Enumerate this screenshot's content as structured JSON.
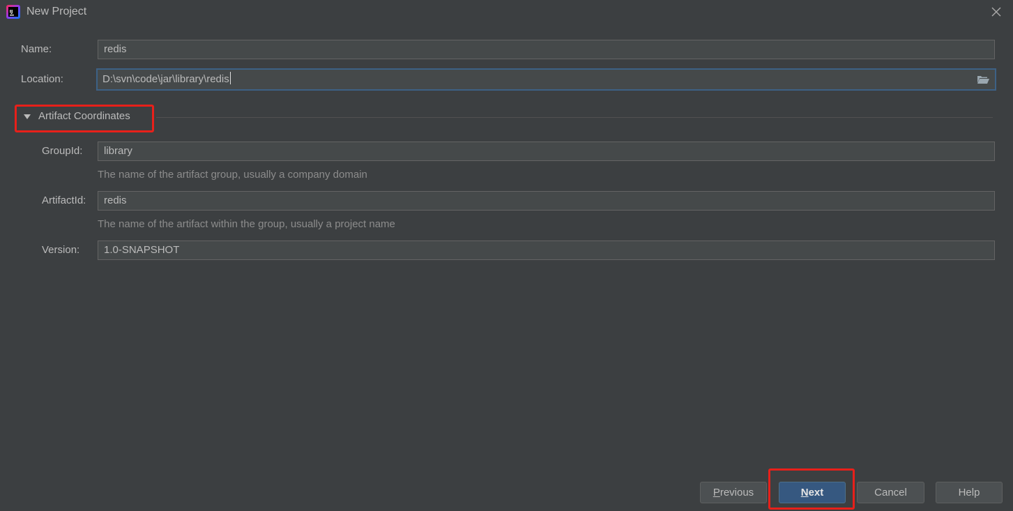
{
  "window": {
    "title": "New Project",
    "app_icon_text": "IJ"
  },
  "form": {
    "name": {
      "label": "Name:",
      "value": "redis"
    },
    "location": {
      "label": "Location:",
      "value": "D:\\svn\\code\\jar\\library\\redis"
    }
  },
  "section": {
    "label": "Artifact Coordinates",
    "expanded": true
  },
  "artifact": {
    "group_id": {
      "label": "GroupId:",
      "value": "library",
      "hint": "The name of the artifact group, usually a company domain"
    },
    "artifact_id": {
      "label": "ArtifactId:",
      "value": "redis",
      "hint": "The name of the artifact within the group, usually a project name"
    },
    "version": {
      "label": "Version:",
      "value": "1.0-SNAPSHOT"
    }
  },
  "buttons": {
    "previous": {
      "mnemonic": "P",
      "rest": "revious"
    },
    "next": {
      "mnemonic": "N",
      "rest": "ext"
    },
    "cancel": "Cancel",
    "help": "Help"
  },
  "colors": {
    "background": "#3c3f41",
    "field_background": "#45494a",
    "focus_border": "#3d6185",
    "primary_button": "#365880",
    "highlight_annotation": "#e8201a"
  }
}
